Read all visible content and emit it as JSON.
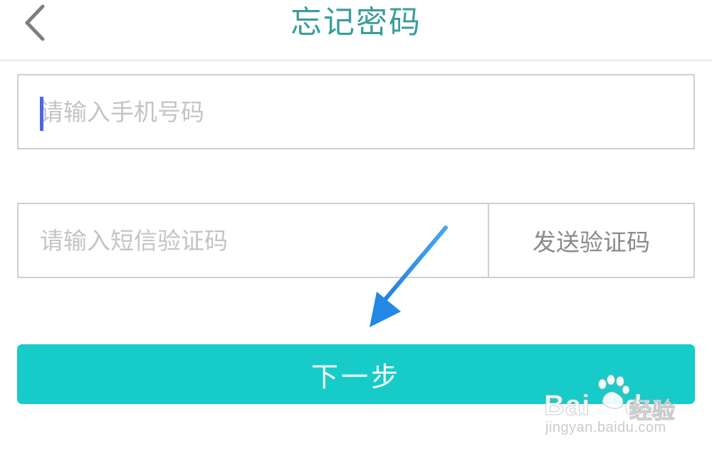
{
  "header": {
    "title": "忘记密码",
    "back_icon": "chevron-left-icon"
  },
  "form": {
    "phone_placeholder": "请输入手机号码",
    "phone_value": "",
    "code_placeholder": "请输入短信验证码",
    "code_value": "",
    "send_code_label": "发送验证码",
    "next_label": "下一步"
  },
  "watermark": {
    "brand": "Bai",
    "brand_tail": "du",
    "product": "经验",
    "url": "jingyan.baidu.com"
  },
  "colors": {
    "title": "#3a9e9a",
    "primary_button": "#17cbc9",
    "border": "#cfcfcf",
    "placeholder": "#c4c4c4",
    "caret": "#4a67e8",
    "arrow": "#2f8fe6"
  }
}
